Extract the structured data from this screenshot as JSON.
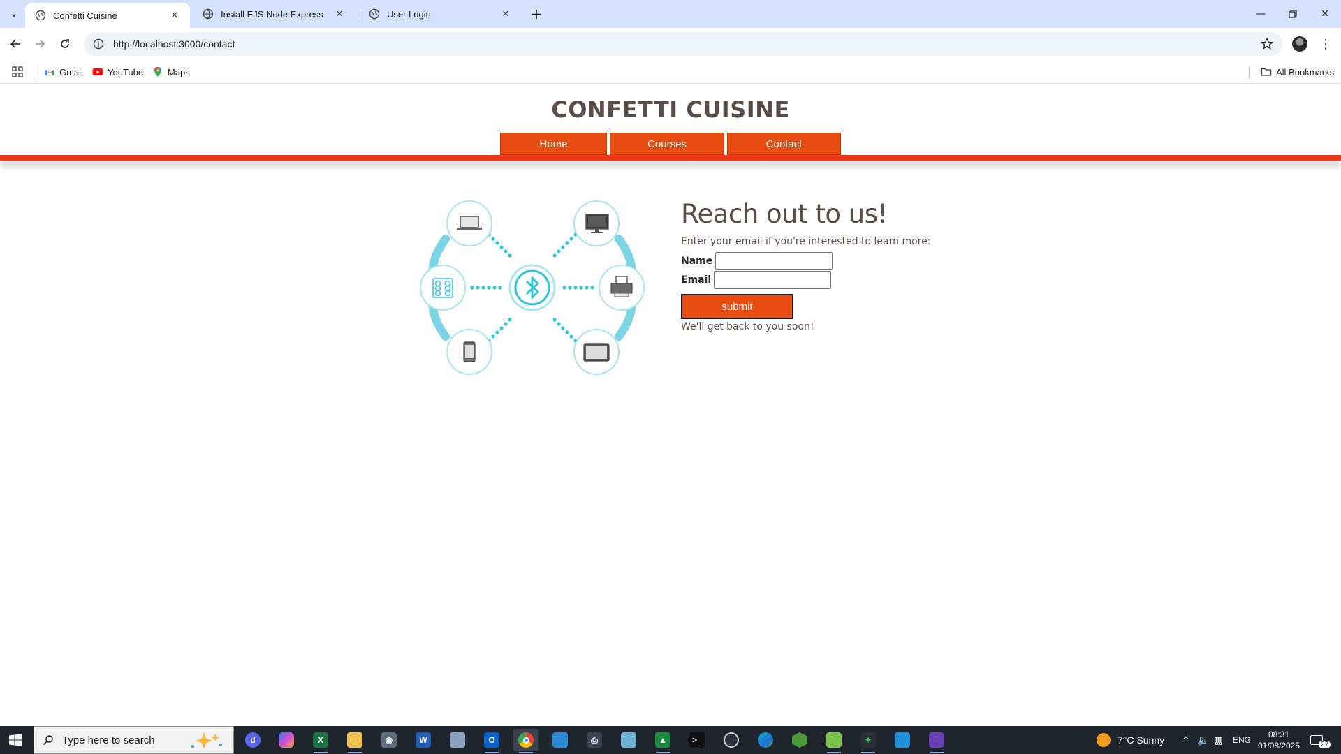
{
  "browser": {
    "tabs": [
      {
        "title": "Confetti Cuisine",
        "active": true
      },
      {
        "title": "Install EJS Node Express",
        "active": false
      },
      {
        "title": "User Login",
        "active": false
      }
    ],
    "url": "http://localhost:3000/contact",
    "bookmarks": [
      {
        "label": "Gmail",
        "icon": "gmail-icon"
      },
      {
        "label": "YouTube",
        "icon": "youtube-icon"
      },
      {
        "label": "Maps",
        "icon": "maps-icon"
      }
    ],
    "all_bookmarks_label": "All Bookmarks"
  },
  "site": {
    "title": "CONFETTI CUISINE",
    "nav": [
      {
        "label": "Home"
      },
      {
        "label": "Courses"
      },
      {
        "label": "Contact"
      }
    ],
    "accent_color": "#e84c10",
    "bar_color": "#ee3b16",
    "text_color": "#5b4c48"
  },
  "contact": {
    "heading": "Reach out to us!",
    "subtitle": "Enter your email if you're interested to learn more:",
    "name_label": "Name",
    "email_label": "Email",
    "name_value": "",
    "email_value": "",
    "submit_label": "submit",
    "footer": "We'll get back to you soon!"
  },
  "taskbar": {
    "search_placeholder": "Type here to search",
    "weather": "7°C  Sunny",
    "language": "ENG",
    "time": "08:31",
    "date": "01/08/2025",
    "notification_count": "27"
  }
}
